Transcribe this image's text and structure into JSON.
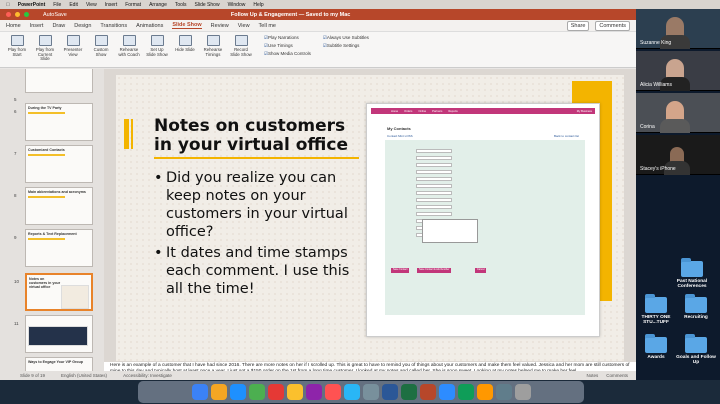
{
  "menubar": {
    "app": "PowerPoint",
    "items": [
      "File",
      "Edit",
      "View",
      "Insert",
      "Format",
      "Arrange",
      "Tools",
      "Slide Show",
      "Window",
      "Help"
    ]
  },
  "window": {
    "autosave": "AutoSave",
    "title": "Follow Up & Engagement — Saved to my Mac"
  },
  "tabs": {
    "items": [
      "Home",
      "Insert",
      "Draw",
      "Design",
      "Transitions",
      "Animations",
      "Slide Show",
      "Review",
      "View",
      "Tell me"
    ],
    "active": "Slide Show",
    "share": "Share",
    "comments": "Comments"
  },
  "ribbon": {
    "buttons": [
      "Play from Start",
      "Play from Current Slide",
      "Presenter View",
      "Custom Show",
      "Rehearse with Coach",
      "Set Up Slide Show",
      "Hide Slide",
      "Rehearse Timings",
      "Record Slide Show"
    ],
    "checks": [
      "Play Narrations",
      "Use Timings",
      "Show Media Controls"
    ],
    "checks2": [
      "Always Use Subtitles",
      "Subtitle Settings"
    ]
  },
  "thumbnails": [
    {
      "num": "5",
      "title": ""
    },
    {
      "num": "6",
      "title": "During the TV Party"
    },
    {
      "num": "7",
      "title": "Customized Contacts"
    },
    {
      "num": "8",
      "title": "Main abbreviations and acronyms"
    },
    {
      "num": "9",
      "title": "Reports & Text Replacement"
    },
    {
      "num": "10",
      "title": "Notes on customers in your virtual office"
    },
    {
      "num": "11",
      "title": ""
    },
    {
      "num": "",
      "title": "Ways to Engage Your VIP Group"
    }
  ],
  "slide": {
    "title": "Notes on customers in your virtual office",
    "bullets": [
      "Did you realize you can keep notes on your customers in your virtual office?",
      "It dates and time stamps each comment.  I use this all the time!"
    ],
    "shot": {
      "heading": "My Contacts",
      "sub": "Contact Mint LOSS",
      "link": "Back to contact list",
      "nav": [
        "Home",
        "Orders",
        "Online",
        "Partners",
        "Reports",
        "My Business"
      ],
      "buttons": [
        "Save Contact",
        "Save Contact & Add Another",
        "Cancel"
      ]
    }
  },
  "notes": "Here is an example of a customer that I have had since 2016.  There are more notes on her if I scrolled up.  This is great to have to remind you of things about your customers and make them feel valued.  Jessica and her mom are still customers of mine to this day and typically host at least once a year.  I just got a $150 order on the 1st from a long time customer.  I looked at my notes and called her.  She is sooo sweet.  Looking at my notes helped me to make her feel",
  "status": {
    "slide": "Slide 9 of 19",
    "language": "English (United States)",
    "accessibility": "Accessibility: Investigate",
    "notes": "Notes",
    "comments": "Comments"
  },
  "zoom": {
    "participants": [
      "Suzanne King",
      "Alicia Williams",
      "Corina",
      "Stacey's iPhone"
    ]
  },
  "desktop": {
    "folders": [
      {
        "label": "Past National Conferences"
      },
      {
        "label": "THIRTY ONE STU...TUFF"
      },
      {
        "label": "Recruiting"
      },
      {
        "label": "Awards"
      },
      {
        "label": "Goals and Follow Up"
      }
    ]
  },
  "colors": {
    "ppt_accent": "#b7472a",
    "slide_yellow": "#f3b400",
    "shot_pink": "#c2367a"
  }
}
